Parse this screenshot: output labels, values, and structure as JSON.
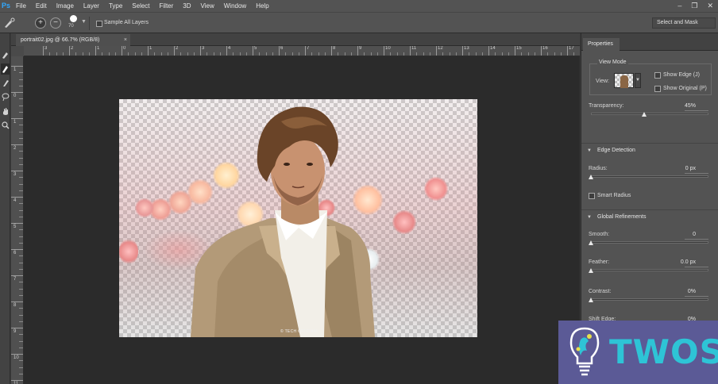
{
  "menu": {
    "app_icon": "Ps",
    "items": [
      "File",
      "Edit",
      "Image",
      "Layer",
      "Type",
      "Select",
      "Filter",
      "3D",
      "View",
      "Window",
      "Help"
    ],
    "window_controls": [
      "–",
      "❐",
      "✕"
    ]
  },
  "options": {
    "brush_size": "70",
    "sample_all_layers": "Sample All Layers",
    "sample_all_layers_checked": false,
    "select_and_mask": "Select and Mask"
  },
  "document": {
    "tab_title": "portrait02.jpg @ 66.7% (RGB/8)",
    "tab_close": "×",
    "ruler_h": [
      "3",
      "2",
      "1",
      "0",
      "1",
      "2",
      "3",
      "4",
      "5",
      "6",
      "7",
      "8",
      "9",
      "10",
      "11",
      "12",
      "13",
      "14",
      "15",
      "16",
      "17"
    ],
    "ruler_v": [
      "1",
      "0",
      "1",
      "2",
      "3",
      "4",
      "5",
      "6",
      "7",
      "8",
      "9",
      "10",
      "11"
    ],
    "image_caption": "© TECH ORIGINAL"
  },
  "properties": {
    "tab": "Properties",
    "view_mode": {
      "title": "View Mode",
      "view_label": "View:",
      "show_edge": "Show Edge (J)",
      "show_edge_checked": false,
      "show_original": "Show Original (P)",
      "show_original_checked": false
    },
    "transparency": {
      "label": "Transparency:",
      "value": "45%",
      "fraction": 0.45
    },
    "edge_detection": {
      "header": "Edge Detection",
      "radius_label": "Radius:",
      "radius_value": "0 px",
      "smart_radius": "Smart Radius",
      "smart_radius_checked": false
    },
    "global_refinements": {
      "header": "Global Refinements",
      "smooth_label": "Smooth:",
      "smooth_value": "0",
      "feather_label": "Feather:",
      "feather_value": "0.0 px",
      "contrast_label": "Contrast:",
      "contrast_value": "0%",
      "shift_edge_label": "Shift Edge:",
      "shift_edge_value": "0%"
    }
  },
  "watermark": {
    "text": "TWOS"
  },
  "colors": {
    "accent": "#31a8ff",
    "panel": "#535353",
    "logo_bg": "#5b5a96",
    "logo_text": "#2ec4d6"
  }
}
